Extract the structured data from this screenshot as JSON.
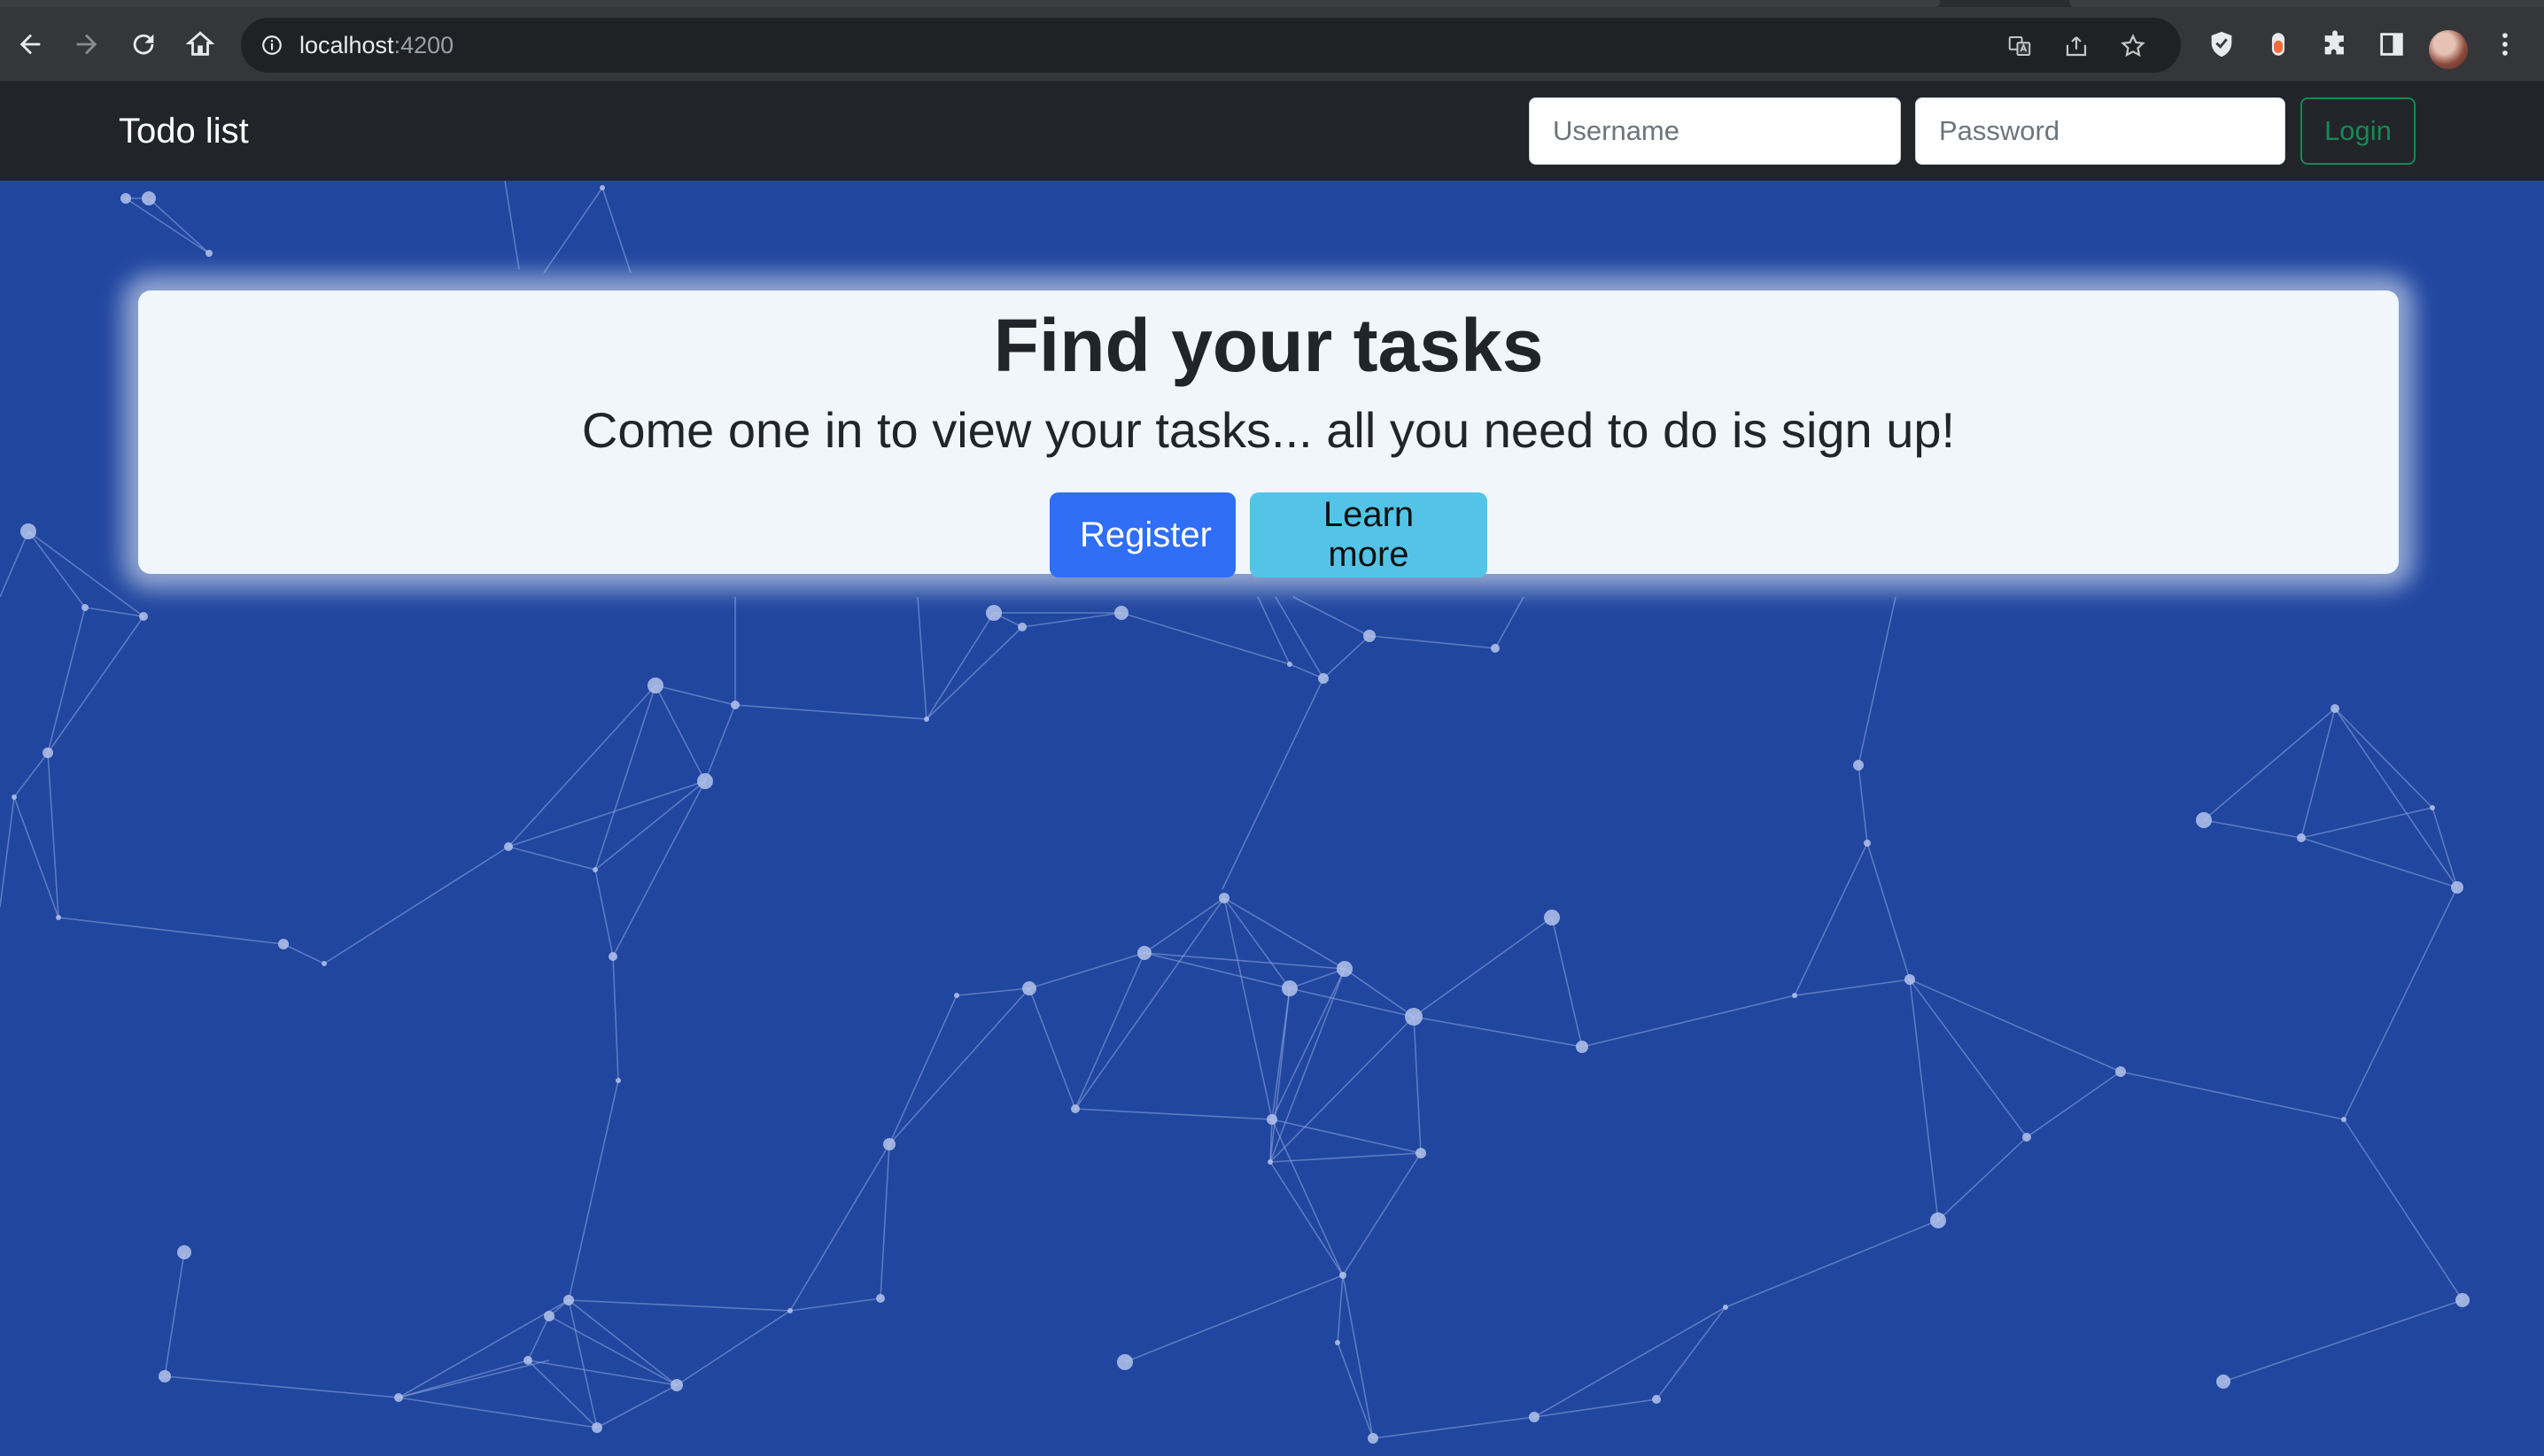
{
  "browser": {
    "url_host": "localhost",
    "url_port": ":4200"
  },
  "navbar": {
    "brand": "Todo list",
    "username_placeholder": "Username",
    "password_placeholder": "Password",
    "login_label": "Login"
  },
  "hero": {
    "title": "Find your tasks",
    "subtitle": "Come one in to view your tasks... all you need to do is sign up!",
    "register_label": "Register",
    "learn_more_label": "Learn more"
  },
  "colors": {
    "background": "#2046a0",
    "navbar": "#212529",
    "primary": "#2f6ef5",
    "info": "#53c4e8",
    "success": "#198754"
  }
}
